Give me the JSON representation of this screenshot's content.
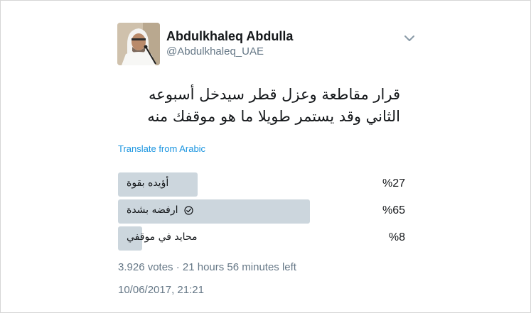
{
  "colors": {
    "text": "#14171a",
    "secondary": "#657786",
    "link": "#1b95e0",
    "poll_bar": "#ccd6dd"
  },
  "user": {
    "display_name": "Abdulkhaleq Abdulla",
    "handle": "@Abdulkhaleq_UAE"
  },
  "tweet": {
    "text": "قرار مقاطعة وعزل قطر سيدخل أسبوعه الثاني وقد يستمر طويلا ما هو موقفك منه",
    "translate_label": "Translate from Arabic"
  },
  "poll": {
    "options": [
      {
        "label": "أؤيده بقوة",
        "percent_text": "%27",
        "percent": 27,
        "selected": false
      },
      {
        "label": "ارفضه بشدة",
        "percent_text": "%65",
        "percent": 65,
        "selected": true
      },
      {
        "label": "محايد في موقفي",
        "percent_text": "%8",
        "percent": 8,
        "selected": false
      }
    ],
    "meta": "3.926 votes · 21 hours 56 minutes left"
  },
  "timestamp": "10/06/2017, 21:21",
  "icons": {
    "chevron": "chevron-down-icon",
    "check": "check-circle-icon"
  }
}
